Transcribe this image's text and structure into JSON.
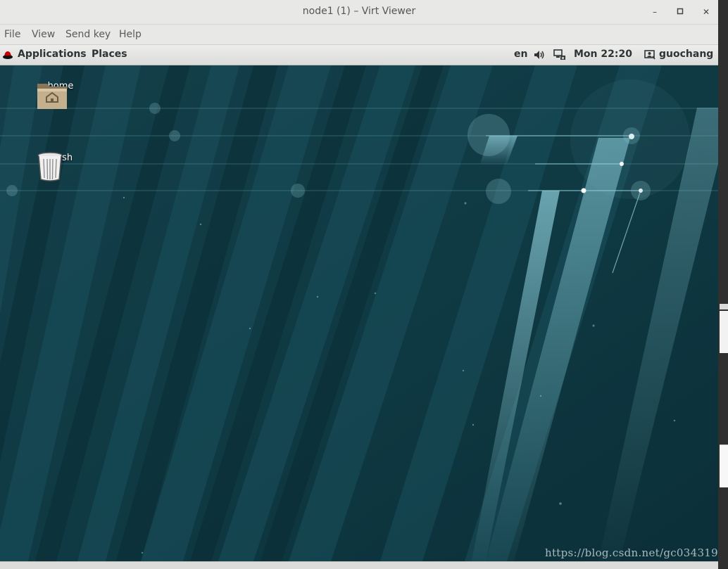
{
  "window": {
    "title": "node1 (1) – Virt Viewer",
    "controls": {
      "minimize": "–",
      "maximize": "▫",
      "close": "✕"
    }
  },
  "menubar": {
    "items": [
      "File",
      "View",
      "Send key",
      "Help"
    ]
  },
  "guest": {
    "topbar": {
      "applications_label": "Applications",
      "places_label": "Places",
      "keyboard_layout": "en",
      "clock": "Mon 22:20",
      "user": "guochang"
    },
    "desktop": {
      "icons": [
        {
          "label": "home",
          "icon": "home-folder-icon"
        },
        {
          "label": "Trash",
          "icon": "trash-icon"
        }
      ]
    }
  },
  "watermark": "https://blog.csdn.net/gc034319",
  "colors": {
    "desktop_bg": "#0f3d48",
    "panel_bg": "#e8e8e7",
    "text_dark": "#2e3436"
  }
}
